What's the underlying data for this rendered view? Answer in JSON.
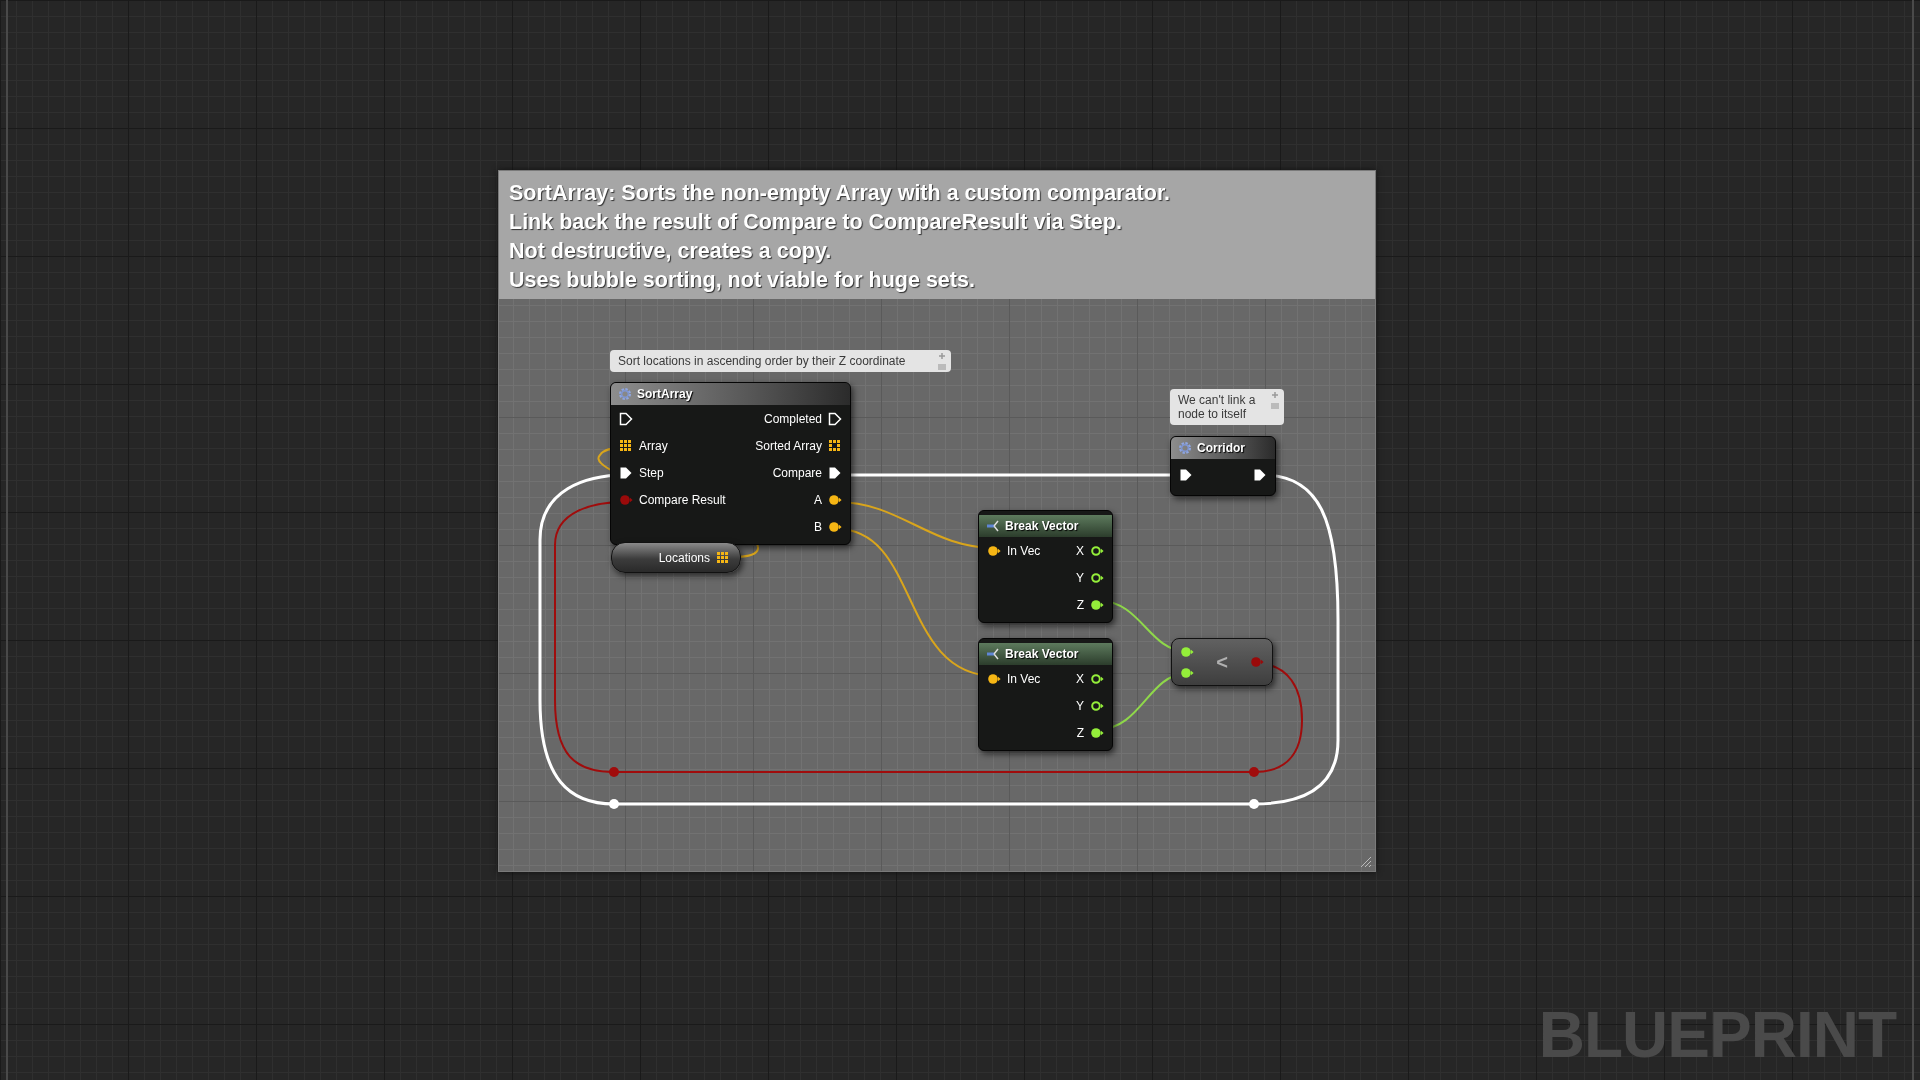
{
  "comment": {
    "lines": [
      "SortArray: Sorts the non-empty Array with a custom comparator.",
      "Link back the result of Compare to CompareResult via Step.",
      "Not destructive, creates a copy.",
      "Uses bubble sorting, not viable for huge sets."
    ]
  },
  "nodes": [
    {
      "kind": "function",
      "title": "SortArray",
      "bubble": "Sort locations in ascending order by their Z coordinate",
      "rows": [
        {
          "left": {
            "kind": "exec",
            "connected": false
          },
          "right": {
            "kind": "exec",
            "label": "Completed",
            "connected": false
          }
        },
        {
          "left": {
            "kind": "array",
            "label": "Array",
            "connected": true
          },
          "right": {
            "kind": "array",
            "label": "Sorted Array",
            "connected": false
          }
        },
        {
          "left": {
            "kind": "exec",
            "label": "Step",
            "connected": true
          },
          "right": {
            "kind": "exec",
            "label": "Compare",
            "connected": true
          }
        },
        {
          "left": {
            "kind": "bool",
            "label": "Compare Result",
            "connected": true
          },
          "right": {
            "kind": "struct",
            "label": "A",
            "connected": true
          }
        },
        {
          "right": {
            "kind": "struct",
            "label": "B",
            "connected": true
          }
        }
      ]
    },
    {
      "kind": "variable",
      "title": "Locations",
      "output": {
        "kind": "array",
        "connected": true
      }
    },
    {
      "kind": "function",
      "title": "Corridor",
      "bubble": "We can't link a node to itself",
      "rows": [
        {
          "left": {
            "kind": "exec",
            "connected": true
          },
          "right": {
            "kind": "exec",
            "connected": true
          }
        }
      ]
    },
    {
      "kind": "break",
      "title": "Break Vector",
      "rows": [
        {
          "left": {
            "kind": "struct",
            "label": "In Vec",
            "connected": true
          },
          "right": {
            "kind": "float",
            "label": "X",
            "connected": false
          }
        },
        {
          "right": {
            "kind": "float",
            "label": "Y",
            "connected": false
          }
        },
        {
          "right": {
            "kind": "float",
            "label": "Z",
            "connected": true
          }
        }
      ]
    },
    {
      "kind": "break",
      "title": "Break Vector",
      "rows": [
        {
          "left": {
            "kind": "struct",
            "label": "In Vec",
            "connected": true
          },
          "right": {
            "kind": "float",
            "label": "X",
            "connected": false
          }
        },
        {
          "right": {
            "kind": "float",
            "label": "Y",
            "connected": false
          }
        },
        {
          "right": {
            "kind": "float",
            "label": "Z",
            "connected": true
          }
        }
      ]
    },
    {
      "kind": "operator",
      "symbol": "<",
      "inputs": [
        {
          "kind": "float",
          "connected": true
        },
        {
          "kind": "float",
          "connected": true
        }
      ],
      "outputs": [
        {
          "kind": "bool",
          "connected": true
        }
      ]
    }
  ],
  "graph_label": "BLUEPRINT"
}
